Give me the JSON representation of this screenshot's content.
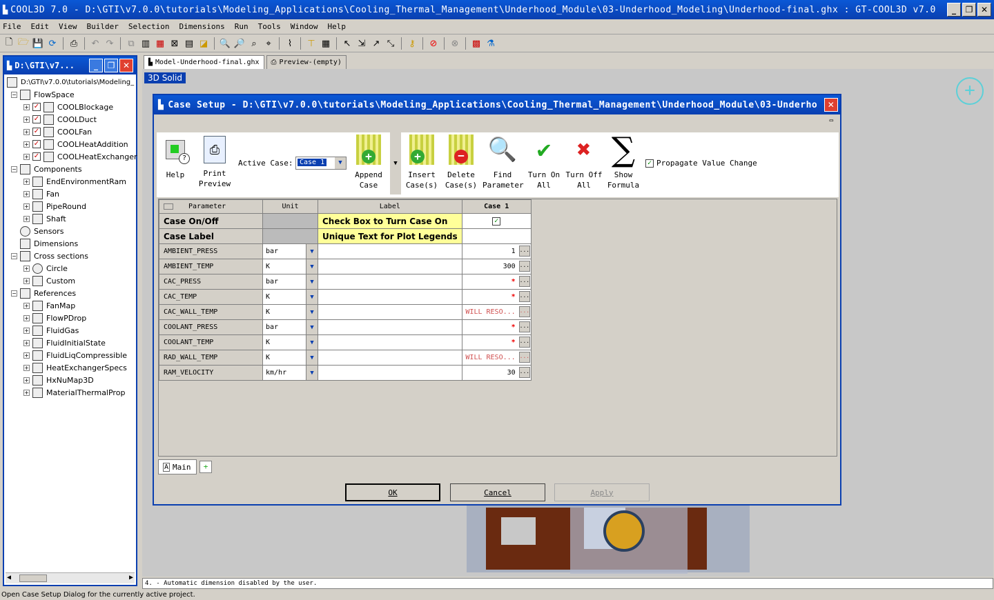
{
  "window": {
    "title": "COOL3D 7.0 - D:\\GTI\\v7.0.0\\tutorials\\Modeling_Applications\\Cooling_Thermal_Management\\Underhood_Module\\03-Underhood_Modeling\\Underhood-final.ghx : GT-COOL3D v7.0"
  },
  "menu": [
    "File",
    "Edit",
    "View",
    "Builder",
    "Selection",
    "Dimensions",
    "Run",
    "Tools",
    "Window",
    "Help"
  ],
  "tree": {
    "title": "D:\\GTI\\v7...",
    "root": "D:\\GTI\\v7.0.0\\tutorials\\Modeling_",
    "items": [
      {
        "label": "FlowSpace",
        "level": 1
      },
      {
        "label": "COOLBlockage",
        "level": 2
      },
      {
        "label": "COOLDuct",
        "level": 2
      },
      {
        "label": "COOLFan",
        "level": 2
      },
      {
        "label": "COOLHeatAddition",
        "level": 2
      },
      {
        "label": "COOLHeatExchanger",
        "level": 2
      },
      {
        "label": "Components",
        "level": 1
      },
      {
        "label": "EndEnvironmentRam",
        "level": 2
      },
      {
        "label": "Fan",
        "level": 2
      },
      {
        "label": "PipeRound",
        "level": 2
      },
      {
        "label": "Shaft",
        "level": 2
      },
      {
        "label": "Sensors",
        "level": 1
      },
      {
        "label": "Dimensions",
        "level": 1
      },
      {
        "label": "Cross sections",
        "level": 1
      },
      {
        "label": "Circle",
        "level": 2
      },
      {
        "label": "Custom",
        "level": 2
      },
      {
        "label": "References",
        "level": 1
      },
      {
        "label": "FanMap",
        "level": 2
      },
      {
        "label": "FlowPDrop",
        "level": 2
      },
      {
        "label": "FluidGas",
        "level": 2
      },
      {
        "label": "FluidInitialState",
        "level": 2
      },
      {
        "label": "FluidLiqCompressible",
        "level": 2
      },
      {
        "label": "HeatExchangerSpecs",
        "level": 2
      },
      {
        "label": "HxNuMap3D",
        "level": 2
      },
      {
        "label": "MaterialThermalProp",
        "level": 2
      }
    ]
  },
  "tabs": {
    "model": "Model-Underhood-final.ghx",
    "preview": "Preview-(empty)"
  },
  "view": {
    "label": "3D Solid"
  },
  "dialog": {
    "title": "Case Setup - D:\\GTI\\v7.0.0\\tutorials\\Modeling_Applications\\Cooling_Thermal_Management\\Underhood_Module\\03-Underhood...",
    "toolbar": {
      "help": "Help",
      "print1": "Print",
      "print2": "Preview",
      "active_case_label": "Active Case:",
      "active_case_value": "Case 1",
      "append1": "Append",
      "append2": "Case",
      "insert1": "Insert",
      "insert2": "Case(s)",
      "delete1": "Delete",
      "delete2": "Case(s)",
      "find1": "Find",
      "find2": "Parameter",
      "turnon1": "Turn On",
      "turnon2": "All",
      "turnoff1": "Turn Off",
      "turnoff2": "All",
      "show1": "Show",
      "show2": "Formula",
      "propagate": "Propagate Value Change"
    },
    "grid": {
      "headers": {
        "parameter": "Parameter",
        "unit": "Unit",
        "label": "Label",
        "case": "Case 1"
      },
      "case_onoff": {
        "name": "Case On/Off",
        "label": "Check Box to Turn Case On",
        "check": "✓"
      },
      "case_label": {
        "name": "Case Label",
        "label": "Unique Text for Plot Legends"
      },
      "rows": [
        {
          "name": "AMBIENT_PRESS",
          "unit": "bar",
          "value": "1"
        },
        {
          "name": "AMBIENT_TEMP",
          "unit": "K",
          "value": "300"
        },
        {
          "name": "CAC_PRESS",
          "unit": "bar",
          "value": "*"
        },
        {
          "name": "CAC_TEMP",
          "unit": "K",
          "value": "*"
        },
        {
          "name": "CAC_WALL_TEMP",
          "unit": "K",
          "value": "WILL RESO..."
        },
        {
          "name": "COOLANT_PRESS",
          "unit": "bar",
          "value": "*"
        },
        {
          "name": "COOLANT_TEMP",
          "unit": "K",
          "value": "*"
        },
        {
          "name": "RAD_WALL_TEMP",
          "unit": "K",
          "value": "WILL RESO..."
        },
        {
          "name": "RAM_VELOCITY",
          "unit": "km/hr",
          "value": "30"
        }
      ]
    },
    "sheet_tab": "Main",
    "buttons": {
      "ok": "OK",
      "cancel": "Cancel",
      "apply": "Apply"
    }
  },
  "message": "4. - Automatic dimension disabled by the user.",
  "status": "Open Case Setup Dialog for the currently active project."
}
